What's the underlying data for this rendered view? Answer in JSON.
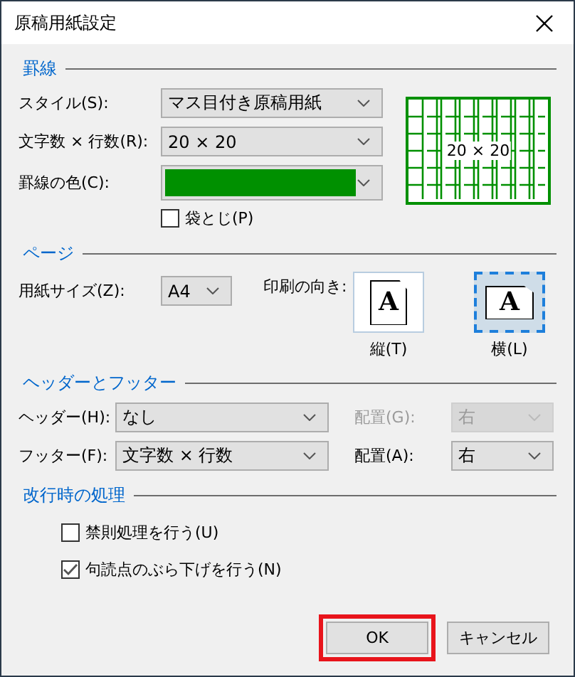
{
  "window": {
    "title": "原稿用紙設定"
  },
  "ruled_lines": {
    "heading": "罫線",
    "style": {
      "label": "スタイル(S):",
      "value": "マス目付き原稿用紙"
    },
    "size": {
      "label": "文字数 × 行数(R):",
      "value": "20 × 20"
    },
    "line_color": {
      "label": "罫線の色(C):",
      "color": "#009000"
    },
    "fukurotoji": {
      "label": "袋とじ(P)",
      "checked": false
    },
    "preview": {
      "text": "20 × 20"
    }
  },
  "page": {
    "heading": "ページ",
    "paper_size": {
      "label": "用紙サイズ(Z):",
      "value": "A4"
    },
    "orientation": {
      "label": "印刷の向き:",
      "options": [
        {
          "label": "縦(T)",
          "glyph": "A",
          "kind": "portrait",
          "selected": false
        },
        {
          "label": "横(L)",
          "glyph": "A",
          "kind": "landscape",
          "selected": true
        }
      ]
    }
  },
  "header_footer": {
    "heading": "ヘッダーとフッター",
    "rows": [
      {
        "label": "ヘッダー(H):",
        "value": "なし",
        "align_label": "配置(G):",
        "align_value": "右",
        "disabled": true
      },
      {
        "label": "フッター(F):",
        "value": "文字数 × 行数",
        "align_label": "配置(A):",
        "align_value": "右",
        "disabled": false
      }
    ]
  },
  "line_break": {
    "heading": "改行時の処理",
    "options": [
      {
        "label": "禁則処理を行う(U)",
        "checked": false
      },
      {
        "label": "句読点のぶら下げを行う(N)",
        "checked": true
      }
    ]
  },
  "buttons": [
    {
      "label": "OK",
      "highlighted": true
    },
    {
      "label": "キャンセル",
      "highlighted": false
    }
  ]
}
